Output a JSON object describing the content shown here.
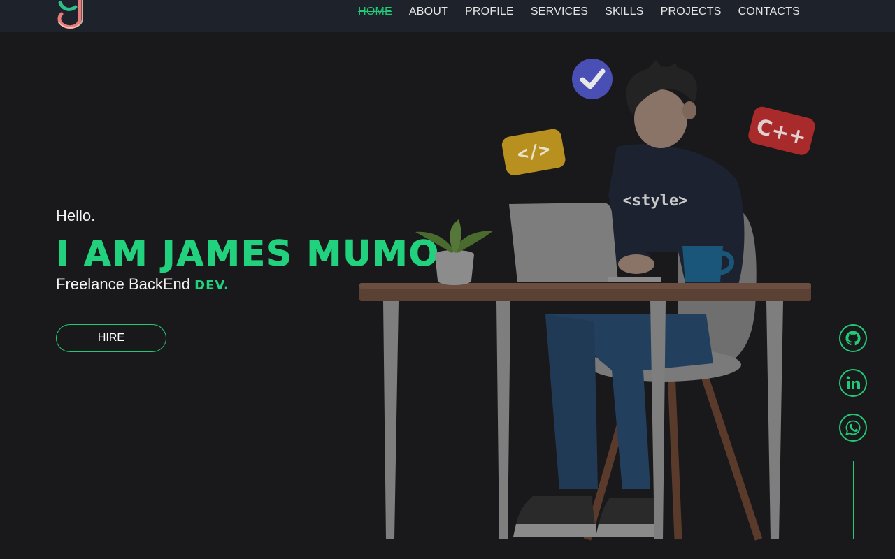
{
  "nav": {
    "items": [
      "HOME",
      "ABOUT",
      "PROFILE",
      "SERVICES",
      "SKILLS",
      "PROJECTS",
      "CONTACTS"
    ],
    "active": "HOME"
  },
  "hero": {
    "greeting": "Hello.",
    "name": "I AM JAMES MUMO",
    "tagline": "Freelance BackEnd",
    "role": "DEV.",
    "hire_label": "HIRE"
  },
  "illustration": {
    "hoodie_text": "<style>",
    "badge_cpp": "C++",
    "badge_code": "</>"
  },
  "social": [
    "github-icon",
    "linkedin-icon",
    "whatsapp-icon"
  ],
  "colors": {
    "accent": "#22c976",
    "background": "#19191b",
    "navbar": "#1e232b"
  }
}
